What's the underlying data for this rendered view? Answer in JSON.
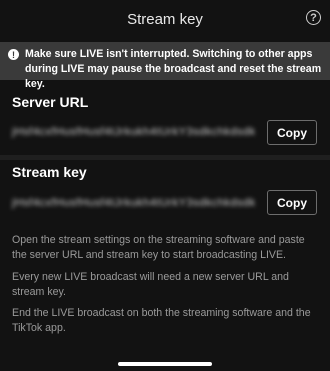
{
  "header": {
    "title": "Stream key",
    "help_glyph": "?"
  },
  "banner": {
    "icon": "info-icon",
    "icon_glyph": "!",
    "text": "Make sure LIVE isn't interrupted. Switching to other apps during LIVE may pause the broadcast and reset the stream key."
  },
  "server_url": {
    "label": "Server URL",
    "value_masked": "jHsf4cxfHusfHusf4tJrkukh4tUrkY3sdkchkdsdk",
    "copy_label": "Copy"
  },
  "stream_key": {
    "label": "Stream key",
    "value_masked": "jHsf4cxfHusfHusf4tJrkukh4tUrkY3sdkchkdsdk",
    "copy_label": "Copy"
  },
  "instructions": [
    "Open the stream settings on the streaming software and paste the server URL and stream key to start broadcasting LIVE.",
    "Every new LIVE broadcast will need a new server URL and stream key.",
    "End the LIVE broadcast on both the streaming software and the TikTok app."
  ],
  "colors": {
    "background": "#121212",
    "banner": "#3a3a3a",
    "muted_text": "#9a9a9a"
  }
}
